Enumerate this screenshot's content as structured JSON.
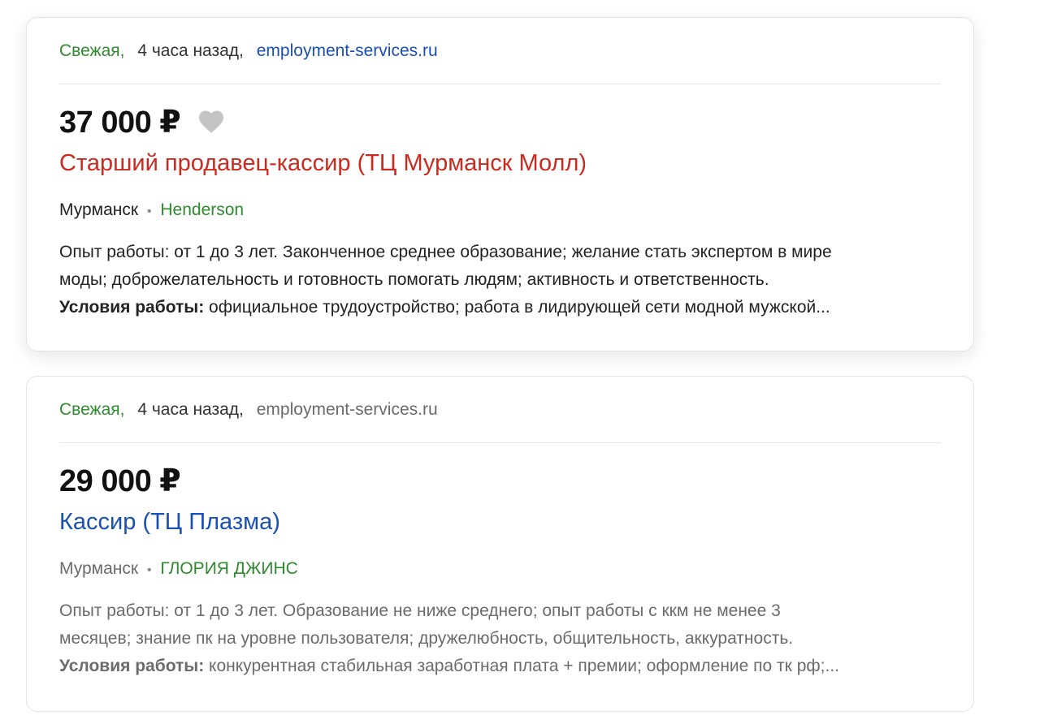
{
  "cards": [
    {
      "freshness": "Свежая,",
      "posted": "4 часа назад,",
      "source": "employment-services.ru",
      "source_color": "#1a4fb4",
      "salary": "37 000 ₽",
      "title": "Старший продавец-кассир (ТЦ Мурманск Молл)",
      "title_color": "#cc2a1e",
      "city": "Мурманск",
      "separator": "•",
      "company": "Henderson",
      "text_color": "#222222",
      "desc_line1": "Опыт работы: от 1 до 3 лет. Законченное среднее образование; желание стать экспертом в мире",
      "desc_line2": "моды; доброжелательность и готовность помогать людям; активность и ответственность.",
      "conditions_label": "Условия работы:",
      "conditions_text": " официальное трудоустройство; работа в лидирующей сети модной мужской...",
      "favorite_icon": "heart-icon"
    },
    {
      "freshness": "Свежая,",
      "posted": "4 часа назад,",
      "source": "employment-services.ru",
      "source_color": "#6b6b6b",
      "salary": "29 000 ₽",
      "title": "Кассир (ТЦ Плазма)",
      "title_color": "#1a4fb4",
      "city": "Мурманск",
      "separator": "•",
      "company": "ГЛОРИЯ ДЖИНС",
      "text_color": "#6b6b6b",
      "desc_line1": "Опыт работы: от 1 до 3 лет. Образование не ниже среднего; опыт работы с ккм не менее 3",
      "desc_line2": "месяцев; знание пк на уровне пользователя; дружелюбность, общительность, аккуратность.",
      "conditions_label": "Условия работы:",
      "conditions_text": " конкурентная стабильная заработная плата + премии; оформление по тк рф;..."
    }
  ]
}
